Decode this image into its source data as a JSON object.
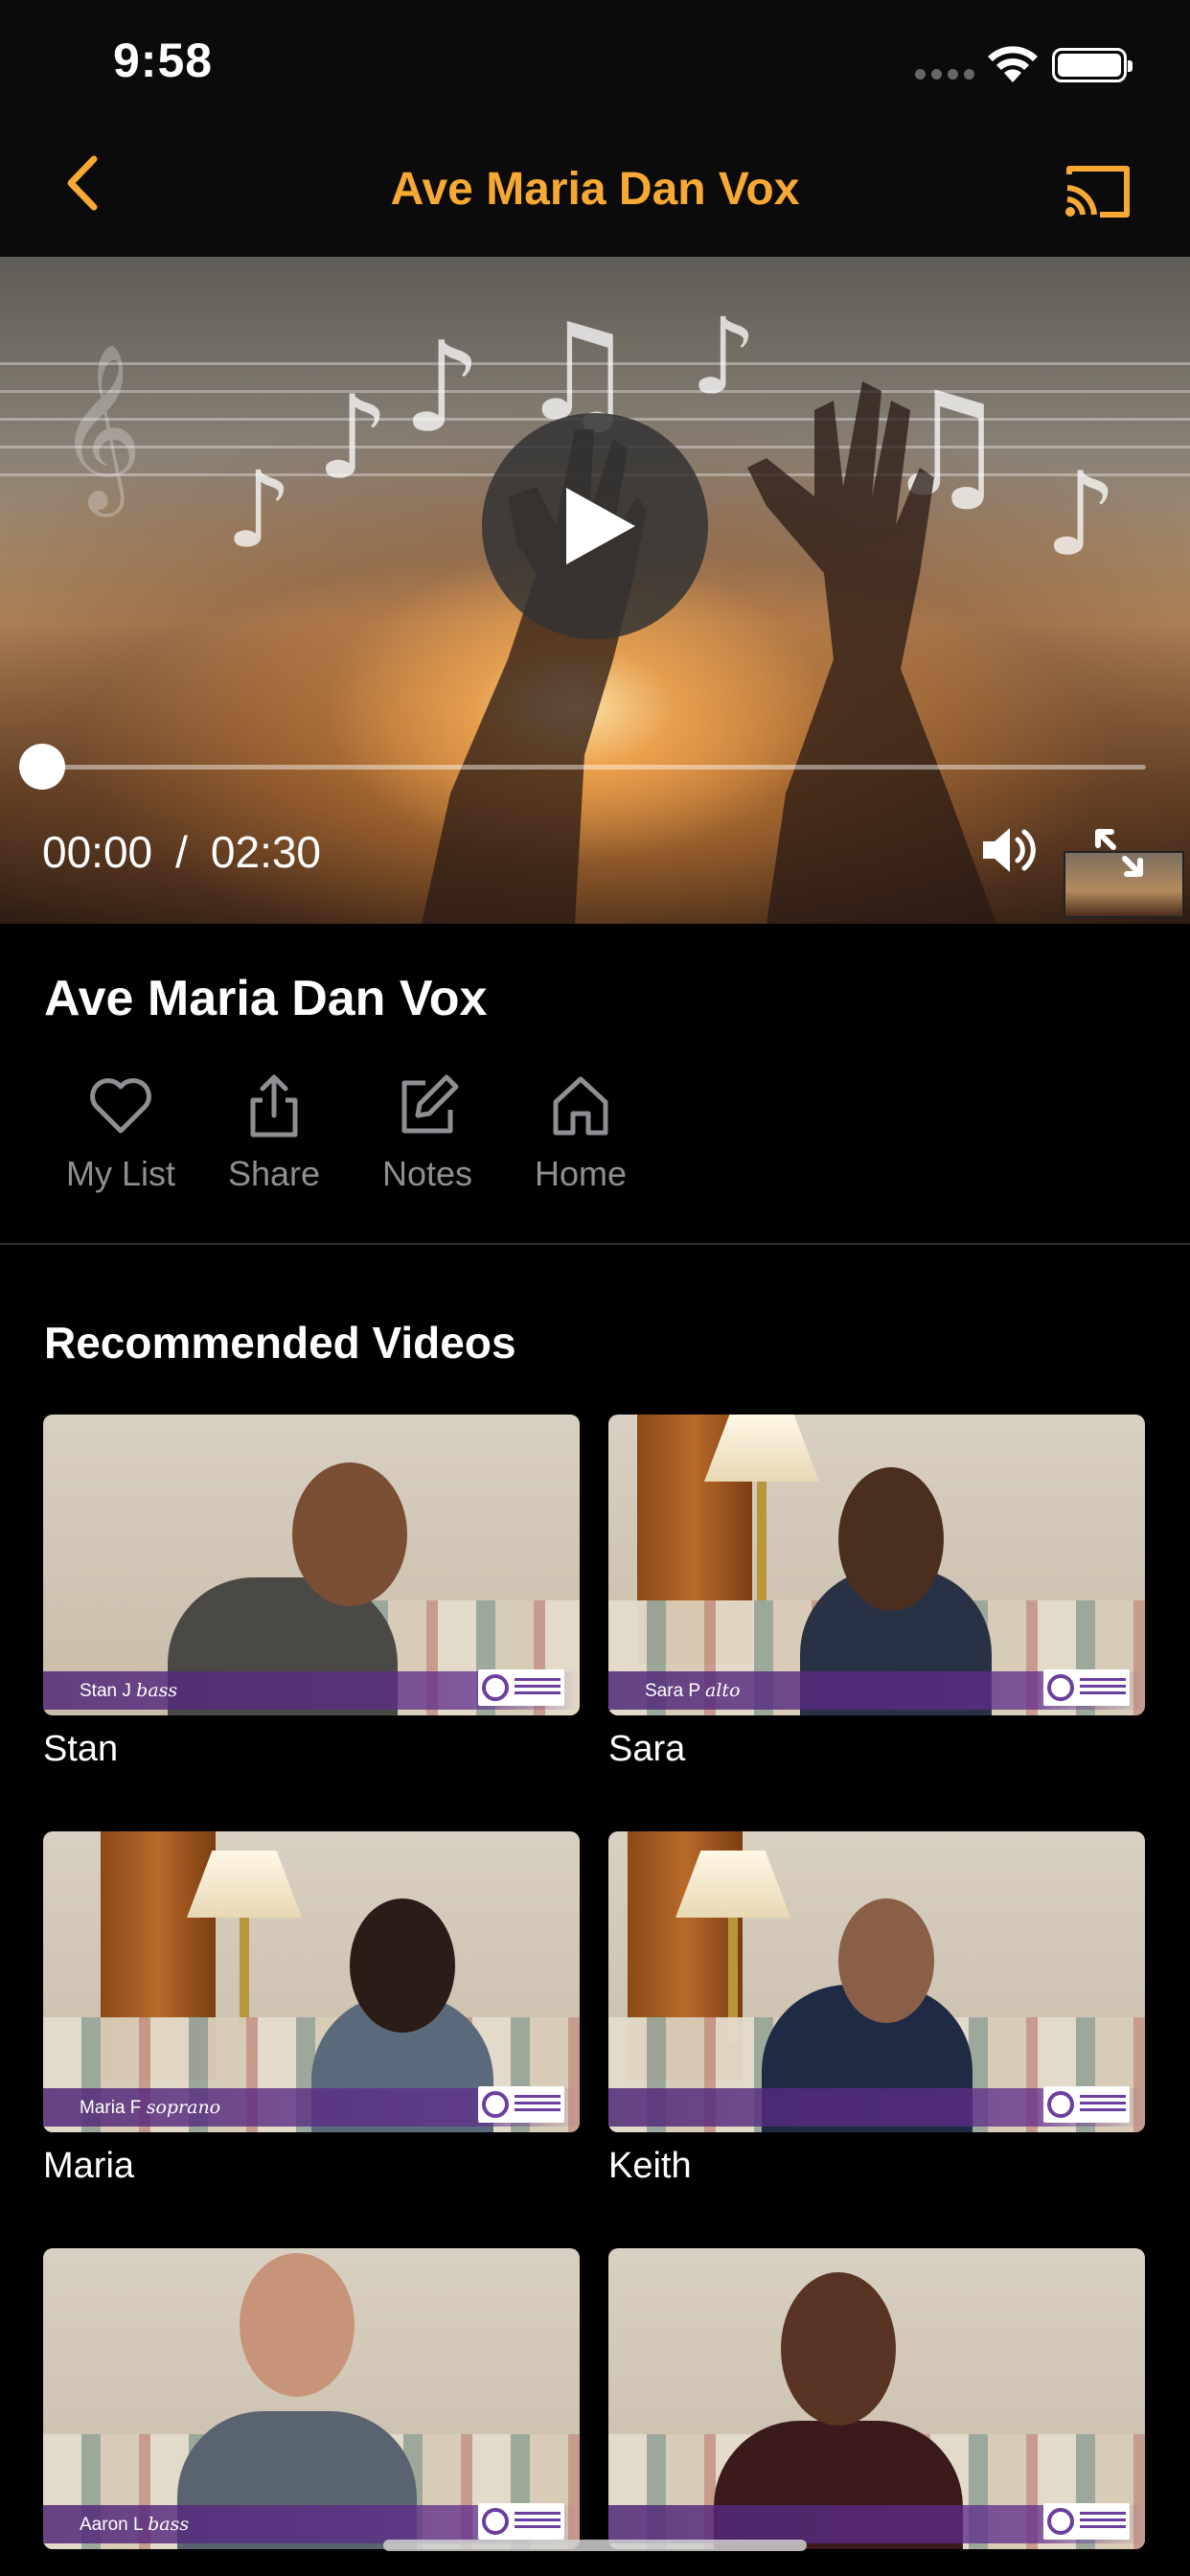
{
  "status_bar": {
    "time": "9:58"
  },
  "nav": {
    "title": "Ave Maria Dan Vox",
    "back_icon": "chevron-left-icon",
    "cast_icon": "cast-icon"
  },
  "player": {
    "current_time": "00:00",
    "separator": "/",
    "duration": "02:30",
    "progress": 0.0
  },
  "video": {
    "title": "Ave Maria Dan Vox"
  },
  "actions": [
    {
      "label": "My List",
      "icon": "heart-icon"
    },
    {
      "label": "Share",
      "icon": "share-icon"
    },
    {
      "label": "Notes",
      "icon": "edit-icon"
    },
    {
      "label": "Home",
      "icon": "home-icon"
    }
  ],
  "recommended": {
    "title": "Recommended Videos",
    "items": [
      {
        "name": "Stan",
        "banner_name": "Stan J",
        "banner_voice": "bass"
      },
      {
        "name": "Sara",
        "banner_name": "Sara P",
        "banner_voice": "alto"
      },
      {
        "name": "Maria",
        "banner_name": "Maria F",
        "banner_voice": "soprano"
      },
      {
        "name": "Keith",
        "banner_name": "",
        "banner_voice": ""
      },
      {
        "name": "",
        "banner_name": "Aaron L",
        "banner_voice": "bass"
      },
      {
        "name": "",
        "banner_name": "",
        "banner_voice": ""
      }
    ]
  },
  "colors": {
    "accent": "#f7a934",
    "background": "#000000",
    "bar_background": "#0b0b0b",
    "muted_label": "#8e8e93"
  }
}
